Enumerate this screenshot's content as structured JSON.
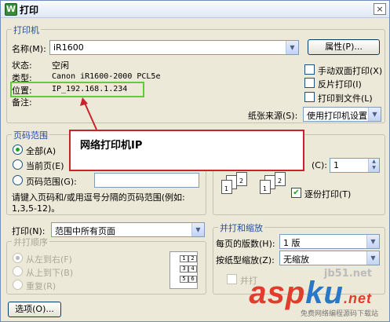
{
  "window": {
    "title": "打印",
    "close_glyph": "×"
  },
  "printer": {
    "group_label": "打印机",
    "name_label": "名称(M):",
    "name_value": "iR1600",
    "properties_button": "属性(P)...",
    "status_label": "状态:",
    "status_value": "空闲",
    "type_label": "类型:",
    "type_value": "Canon iR1600-2000 PCL5e",
    "location_label": "位置:",
    "location_value": "IP_192.168.1.234",
    "comment_label": "备注:",
    "manual_duplex_label": "手动双面打印(X)",
    "reverse_print_label": "反片打印(I)",
    "print_to_file_label": "打印到文件(L)",
    "paper_source_label": "纸张来源(S):",
    "paper_source_value": "使用打印机设置"
  },
  "callout": {
    "text": "网络打印机IP",
    "arrow_color": "#c8232b",
    "border_color": "#c8232b",
    "highlight_color": "#63c93f"
  },
  "page_range": {
    "group_label": "页码范围",
    "all_label": "全部(A)",
    "current_label": "当前页(E)",
    "pages_label": "页码范围(G):",
    "pages_value": "",
    "hint_text": "请键入页码和/或用逗号分隔的页码范围(例如:",
    "hint_example": "1,3,5-12)。",
    "selected": "all"
  },
  "copies": {
    "count_label_suffix": "(C):",
    "count_value": "1",
    "collate_label": "逐份打印(T)",
    "collate_checked": true,
    "page_icons": [
      "1",
      "1",
      "2",
      "2"
    ]
  },
  "print_what": {
    "label": "打印(N):",
    "value": "范围中所有页面"
  },
  "print_order": {
    "group_label": "并打顺序",
    "options": [
      "从左到右(F)",
      "从上到下(B)",
      "重复(R)"
    ],
    "selected": 0,
    "grid_cells": [
      "1",
      "2",
      "3",
      "4",
      "5",
      "6"
    ]
  },
  "zoom": {
    "group_label": "并打和缩放",
    "pages_per_sheet_label": "每页的版数(H):",
    "pages_per_sheet_value": "1 版",
    "scale_label": "按纸型缩放(Z):",
    "scale_value": "无缩放",
    "merge_label": "并打"
  },
  "footer": {
    "options_button": "选项(O)..."
  },
  "watermark": {
    "site_prefix": "jb51.net",
    "brand_red": "asp",
    "brand_blue": "ku",
    "brand_tld": ".net",
    "tagline": "免费网络编程源码下载站"
  },
  "colors": {
    "group_title": "#1e4ea8",
    "accent_check": "#21a121",
    "dialog_bg": "#ece9d8"
  }
}
